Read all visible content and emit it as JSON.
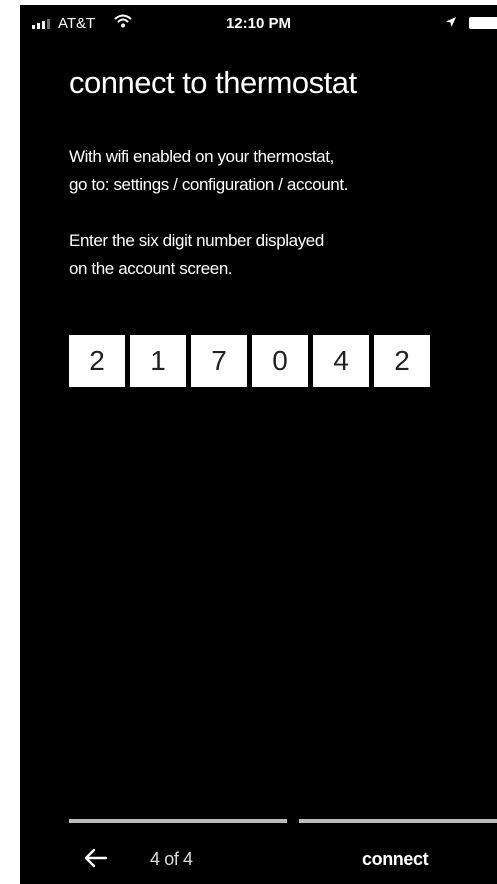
{
  "status_bar": {
    "carrier": "AT&T",
    "time": "12:10 PM",
    "icons": [
      "signal-icon",
      "wifi-icon",
      "location-arrow-icon",
      "battery-icon"
    ]
  },
  "title": "connect to thermostat",
  "instructions": {
    "line1": "With wifi enabled on your thermostat,\ngo to: settings / configuration / account.",
    "line2": "Enter the six digit number displayed\non the account screen."
  },
  "code": [
    "2",
    "1",
    "7",
    "0",
    "4",
    "2"
  ],
  "footer": {
    "back_icon": "arrow-left-icon",
    "step": "4 of 4",
    "connect_label": "connect"
  },
  "progress": {
    "current": 4,
    "total": 4
  },
  "colors": {
    "background": "#000000",
    "text": "#ffffff",
    "digit_box": "#ffffff",
    "digit_text": "#222222",
    "progress_bar": "#bbbbbb"
  }
}
